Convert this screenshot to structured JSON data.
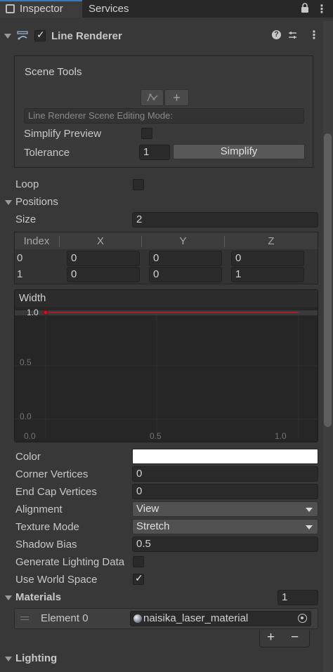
{
  "tabs": [
    {
      "label": "Inspector",
      "active": true
    },
    {
      "label": "Services",
      "active": false
    }
  ],
  "component": {
    "title": "Line Renderer",
    "enabled": true,
    "help_icon": "?",
    "menu_icon": "⋮"
  },
  "scene_tools": {
    "title": "Scene Tools",
    "mode_placeholder": "Line Renderer Scene Editing Mode:",
    "simplify_preview_label": "Simplify Preview",
    "simplify_preview_checked": false,
    "tolerance_label": "Tolerance",
    "tolerance_value": "1",
    "simplify_button": "Simplify"
  },
  "loop": {
    "label": "Loop",
    "checked": false
  },
  "positions": {
    "label": "Positions",
    "size_label": "Size",
    "size_value": "2",
    "columns": [
      "Index",
      "X",
      "Y",
      "Z"
    ],
    "rows": [
      {
        "index": "0",
        "x": "0",
        "y": "0",
        "z": "0"
      },
      {
        "index": "1",
        "x": "0",
        "y": "0",
        "z": "1"
      }
    ]
  },
  "width_curve": {
    "label": "Width",
    "y_ticks": [
      "1.0",
      "0.5",
      "0.0"
    ],
    "x_ticks": [
      "0.0",
      "0.5",
      "1.0"
    ],
    "curve_color": "#c8141e",
    "key_value": 1.0
  },
  "properties": {
    "color_label": "Color",
    "color_value": "#ffffff",
    "corner_vertices_label": "Corner Vertices",
    "corner_vertices_value": "0",
    "end_cap_vertices_label": "End Cap Vertices",
    "end_cap_vertices_value": "0",
    "alignment_label": "Alignment",
    "alignment_value": "View",
    "texture_mode_label": "Texture Mode",
    "texture_mode_value": "Stretch",
    "shadow_bias_label": "Shadow Bias",
    "shadow_bias_value": "0.5",
    "generate_lighting_label": "Generate Lighting Data",
    "generate_lighting_checked": false,
    "use_world_space_label": "Use World Space",
    "use_world_space_checked": true
  },
  "materials": {
    "label": "Materials",
    "count": "1",
    "element_label": "Element 0",
    "element_value": "naisika_laser_material",
    "add_label": "+",
    "remove_label": "−"
  },
  "lighting": {
    "label": "Lighting"
  }
}
